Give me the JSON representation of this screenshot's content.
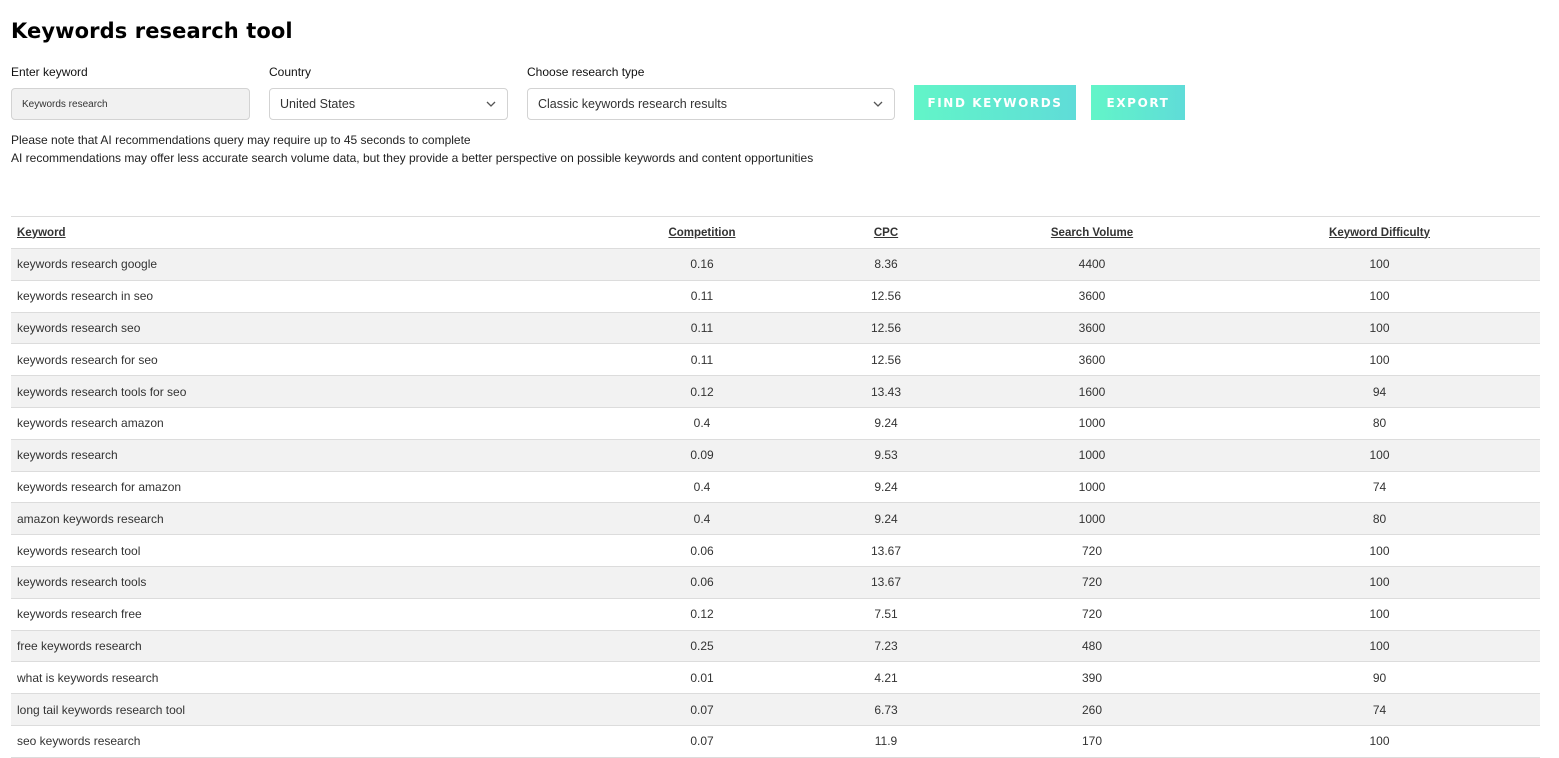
{
  "page": {
    "title": "Keywords research tool"
  },
  "form": {
    "keyword": {
      "label": "Enter keyword",
      "value": "Keywords research"
    },
    "country": {
      "label": "Country",
      "selected": "United States",
      "icon": "chevron-down-icon"
    },
    "research_type": {
      "label": "Choose research type",
      "selected": "Classic keywords research results",
      "icon": "chevron-down-icon"
    },
    "find_button_label": "FIND KEYWORDS",
    "export_button_label": "EXPORT",
    "button_gradient": [
      "#62f5c8",
      "#5fdcd8"
    ]
  },
  "notes": [
    "Please note that AI recommendations query may require up to 45 seconds to complete",
    "AI recommendations may offer less accurate search volume data, but they provide a better perspective on possible keywords and content opportunities"
  ],
  "table": {
    "columns": [
      "Keyword",
      "Competition",
      "CPC",
      "Search Volume",
      "Keyword Difficulty"
    ],
    "rows": [
      {
        "keyword": "keywords research google",
        "competition": "0.16",
        "cpc": "8.36",
        "volume": "4400",
        "difficulty": "100"
      },
      {
        "keyword": "keywords research in seo",
        "competition": "0.11",
        "cpc": "12.56",
        "volume": "3600",
        "difficulty": "100"
      },
      {
        "keyword": "keywords research seo",
        "competition": "0.11",
        "cpc": "12.56",
        "volume": "3600",
        "difficulty": "100"
      },
      {
        "keyword": "keywords research for seo",
        "competition": "0.11",
        "cpc": "12.56",
        "volume": "3600",
        "difficulty": "100"
      },
      {
        "keyword": "keywords research tools for seo",
        "competition": "0.12",
        "cpc": "13.43",
        "volume": "1600",
        "difficulty": "94"
      },
      {
        "keyword": "keywords research amazon",
        "competition": "0.4",
        "cpc": "9.24",
        "volume": "1000",
        "difficulty": "80"
      },
      {
        "keyword": "keywords research",
        "competition": "0.09",
        "cpc": "9.53",
        "volume": "1000",
        "difficulty": "100"
      },
      {
        "keyword": "keywords research for amazon",
        "competition": "0.4",
        "cpc": "9.24",
        "volume": "1000",
        "difficulty": "74"
      },
      {
        "keyword": "amazon keywords research",
        "competition": "0.4",
        "cpc": "9.24",
        "volume": "1000",
        "difficulty": "80"
      },
      {
        "keyword": "keywords research tool",
        "competition": "0.06",
        "cpc": "13.67",
        "volume": "720",
        "difficulty": "100"
      },
      {
        "keyword": "keywords research tools",
        "competition": "0.06",
        "cpc": "13.67",
        "volume": "720",
        "difficulty": "100"
      },
      {
        "keyword": "keywords research free",
        "competition": "0.12",
        "cpc": "7.51",
        "volume": "720",
        "difficulty": "100"
      },
      {
        "keyword": "free keywords research",
        "competition": "0.25",
        "cpc": "7.23",
        "volume": "480",
        "difficulty": "100"
      },
      {
        "keyword": "what is keywords research",
        "competition": "0.01",
        "cpc": "4.21",
        "volume": "390",
        "difficulty": "90"
      },
      {
        "keyword": "long tail keywords research tool",
        "competition": "0.07",
        "cpc": "6.73",
        "volume": "260",
        "difficulty": "74"
      },
      {
        "keyword": "seo keywords research",
        "competition": "0.07",
        "cpc": "11.9",
        "volume": "170",
        "difficulty": "100"
      }
    ]
  }
}
